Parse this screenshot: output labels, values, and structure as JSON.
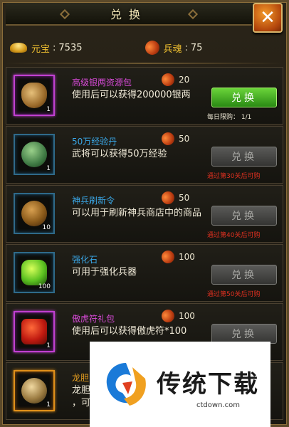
{
  "header": {
    "title": "兑换",
    "close_label": "✕"
  },
  "currency": {
    "yuanbao_label": "元宝",
    "yuanbao_value": "7535",
    "soul_label": "兵魂",
    "soul_value": "75"
  },
  "items": [
    {
      "name": "高级银两资源包",
      "cost": "20",
      "desc": "使用后可以获得200000银两",
      "qty": "1",
      "button": "兑换",
      "limit": "每日限购： 1/1",
      "requirement": ""
    },
    {
      "name": "50万经验丹",
      "cost": "50",
      "desc": "武将可以获得50万经验",
      "qty": "1",
      "button": "兑换",
      "limit": "",
      "requirement": "通过第30关后可购"
    },
    {
      "name": "神兵刷新令",
      "cost": "50",
      "desc": "可以用于刷新神兵商店中的商品",
      "qty": "10",
      "button": "兑换",
      "limit": "",
      "requirement": "通过第40关后可购"
    },
    {
      "name": "强化石",
      "cost": "100",
      "desc": "可用于强化兵器",
      "qty": "100",
      "button": "兑换",
      "limit": "",
      "requirement": "通过第50关后可购"
    },
    {
      "name": "傲虎符礼包",
      "cost": "100",
      "desc": "使用后可以获得傲虎符*100",
      "qty": "1",
      "button": "兑换",
      "limit": "",
      "requirement": ""
    },
    {
      "name": "龙胆",
      "cost": "",
      "desc": "龙胆\n，可",
      "qty": "1",
      "button": "",
      "limit": "",
      "requirement": ""
    }
  ],
  "watermark": {
    "text": "传统下载",
    "url": "ctdown.com"
  },
  "colors": {
    "accent_green": "#3aa820",
    "name_purple": "#d64ad6",
    "name_blue": "#3aa8e8",
    "requirement_red": "#e03020",
    "close_orange": "#e06a14"
  }
}
